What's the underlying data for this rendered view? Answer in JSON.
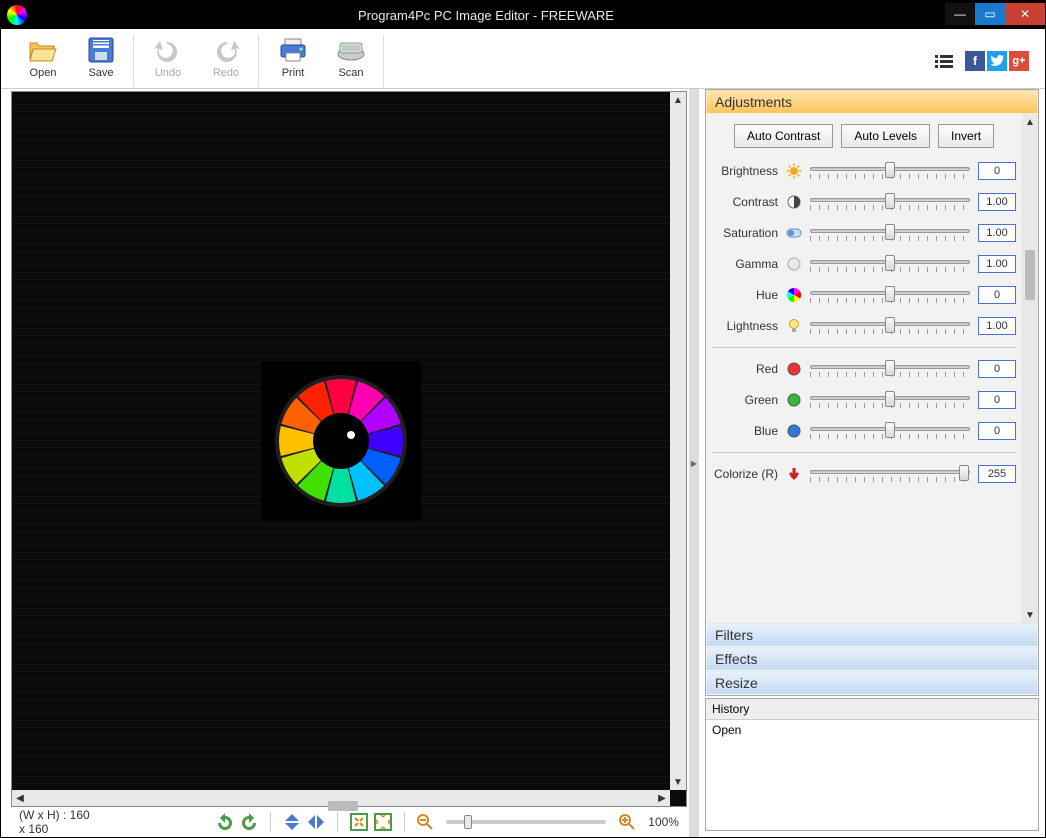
{
  "window": {
    "title": "Program4Pc PC Image Editor - FREEWARE"
  },
  "toolbar": {
    "open": "Open",
    "save": "Save",
    "undo": "Undo",
    "redo": "Redo",
    "print": "Print",
    "scan": "Scan"
  },
  "statusbar": {
    "dimensions": "(W x H) : 160 x 160",
    "zoom": "100%"
  },
  "panel": {
    "adjustments": {
      "title": "Adjustments",
      "auto_contrast": "Auto Contrast",
      "auto_levels": "Auto Levels",
      "invert": "Invert",
      "sliders": [
        {
          "label": "Brightness",
          "value": "0",
          "thumb": 50,
          "icon": "sun",
          "color": "#f7a71b"
        },
        {
          "label": "Contrast",
          "value": "1.00",
          "thumb": 50,
          "icon": "halfcircle",
          "color": "#888"
        },
        {
          "label": "Saturation",
          "value": "1.00",
          "thumb": 50,
          "icon": "toggle",
          "color": "#5b8fd6"
        },
        {
          "label": "Gamma",
          "value": "1.00",
          "thumb": 50,
          "icon": "circle",
          "color": "#ccc"
        },
        {
          "label": "Hue",
          "value": "0",
          "thumb": 50,
          "icon": "wheel",
          "color": ""
        },
        {
          "label": "Lightness",
          "value": "1.00",
          "thumb": 50,
          "icon": "bulb",
          "color": "#e8c64a"
        }
      ],
      "rgb": [
        {
          "label": "Red",
          "value": "0",
          "thumb": 50,
          "color": "#e33"
        },
        {
          "label": "Green",
          "value": "0",
          "thumb": 50,
          "color": "#3b3"
        },
        {
          "label": "Blue",
          "value": "0",
          "thumb": 50,
          "color": "#37d"
        }
      ],
      "colorize": {
        "label": "Colorize (R)",
        "value": "255",
        "thumb": 96,
        "color": "#c22"
      }
    },
    "filters": "Filters",
    "effects": "Effects",
    "resize": "Resize"
  },
  "history": {
    "title": "History",
    "items": [
      "Open"
    ]
  }
}
